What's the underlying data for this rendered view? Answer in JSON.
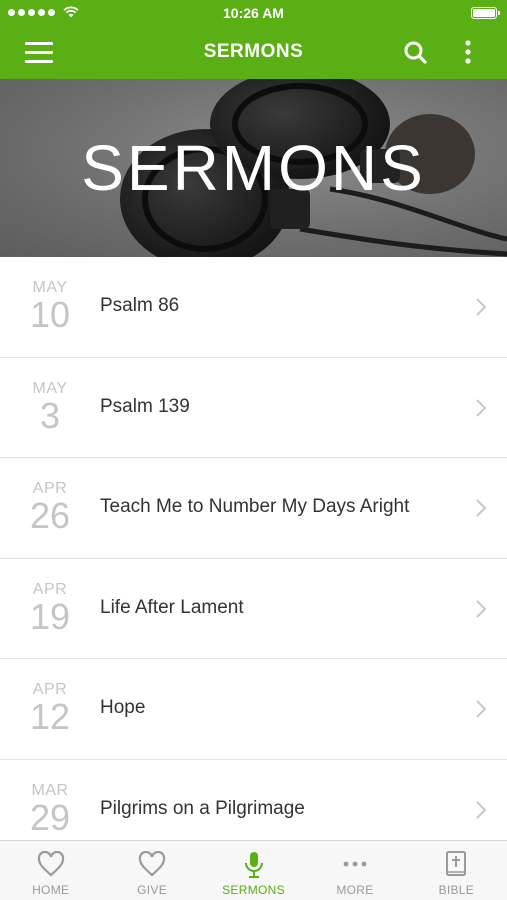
{
  "status_bar": {
    "time": "10:26 AM"
  },
  "header": {
    "title": "SERMONS"
  },
  "hero": {
    "title": "SERMONS"
  },
  "sermons": [
    {
      "month": "MAY",
      "day": "10",
      "title": "Psalm 86"
    },
    {
      "month": "MAY",
      "day": "3",
      "title": "Psalm 139"
    },
    {
      "month": "APR",
      "day": "26",
      "title": "Teach Me to Number My Days Aright"
    },
    {
      "month": "APR",
      "day": "19",
      "title": "Life After Lament"
    },
    {
      "month": "APR",
      "day": "12",
      "title": "Hope"
    },
    {
      "month": "MAR",
      "day": "29",
      "title": "Pilgrims on a Pilgrimage"
    }
  ],
  "tabs": [
    {
      "label": "HOME",
      "icon": "heart-icon"
    },
    {
      "label": "GIVE",
      "icon": "heart-icon"
    },
    {
      "label": "SERMONS",
      "icon": "microphone-icon",
      "active": true
    },
    {
      "label": "MORE",
      "icon": "more-dots-icon"
    },
    {
      "label": "BIBLE",
      "icon": "bible-icon"
    }
  ],
  "colors": {
    "brand_green": "#5aaf14",
    "date_gray": "#c5c5c5",
    "title_text": "#333333",
    "tab_inactive": "#9a9a9a"
  }
}
